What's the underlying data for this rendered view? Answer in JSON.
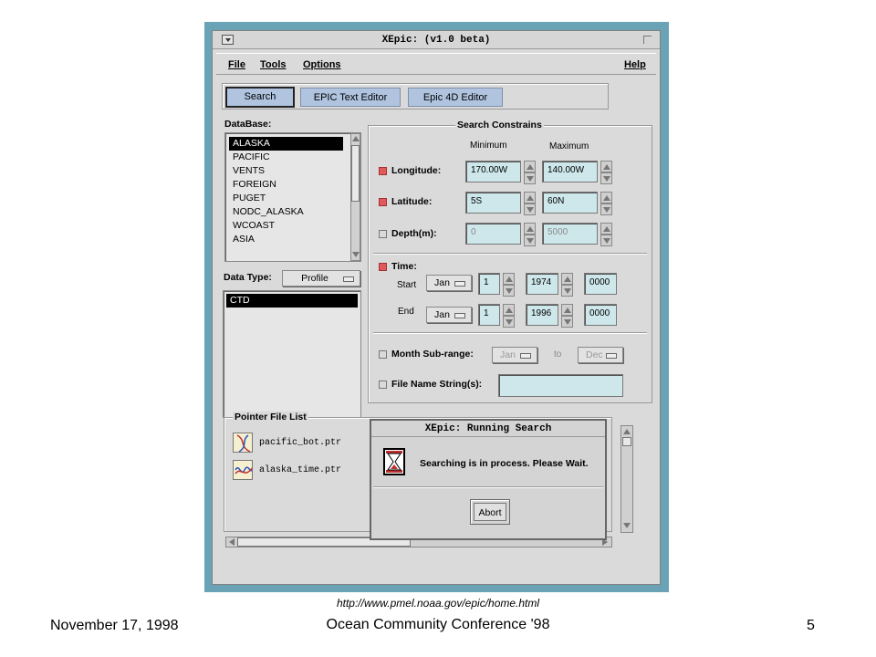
{
  "window": {
    "title": "XEpic: (v1.0 beta)"
  },
  "menubar": {
    "file": "File",
    "tools": "Tools",
    "options": "Options",
    "help": "Help"
  },
  "toolbar": {
    "search": "Search",
    "text_editor": "EPIC Text Editor",
    "editor_4d": "Epic 4D Editor"
  },
  "database": {
    "label": "DataBase:",
    "items": [
      "ALASKA",
      "PACIFIC",
      "VENTS",
      "FOREIGN",
      "PUGET",
      "NODC_ALASKA",
      "WCOAST",
      "ASIA"
    ],
    "selected": "ALASKA"
  },
  "datatype": {
    "label": "Data Type:",
    "value": "Profile",
    "items": [
      "CTD"
    ],
    "selected": "CTD"
  },
  "constraints": {
    "title": "Search Constrains",
    "minimum_label": "Minimum",
    "maximum_label": "Maximum",
    "longitude": {
      "label": "Longitude:",
      "checked": true,
      "min": "170.00W",
      "max": "140.00W"
    },
    "latitude": {
      "label": "Latitude:",
      "checked": true,
      "min": "5S",
      "max": "60N"
    },
    "depth": {
      "label": "Depth(m):",
      "checked": false,
      "min": "0",
      "max": "5000"
    },
    "time": {
      "label": "Time:",
      "checked": true,
      "start_label": "Start",
      "end_label": "End",
      "start": {
        "month": "Jan",
        "day": "1",
        "year": "1974",
        "hour": "0000"
      },
      "end": {
        "month": "Jan",
        "day": "1",
        "year": "1996",
        "hour": "0000"
      }
    },
    "month_subrange": {
      "label": "Month Sub-range:",
      "checked": false,
      "from": "Jan",
      "to_label": "to",
      "to": "Dec"
    },
    "file_name_string": {
      "label": "File Name String(s):",
      "checked": false,
      "value": ""
    }
  },
  "pointer_files": {
    "title": "Pointer File List",
    "items": [
      "pacific_bot.ptr",
      "alaska_time.ptr"
    ]
  },
  "dialog": {
    "title": "XEpic: Running Search",
    "message": "Searching is in process. Please Wait.",
    "abort": "Abort"
  },
  "footer": {
    "url": "http://www.pmel.noaa.gov/epic/home.html",
    "date": "November 17, 1998",
    "conference": "Ocean Community Conference '98",
    "page": "5"
  },
  "colors": {
    "frame": "#6ba3b6",
    "button": "#b0c4e0",
    "field": "#cde7ea",
    "checked": "#e05a5a"
  }
}
